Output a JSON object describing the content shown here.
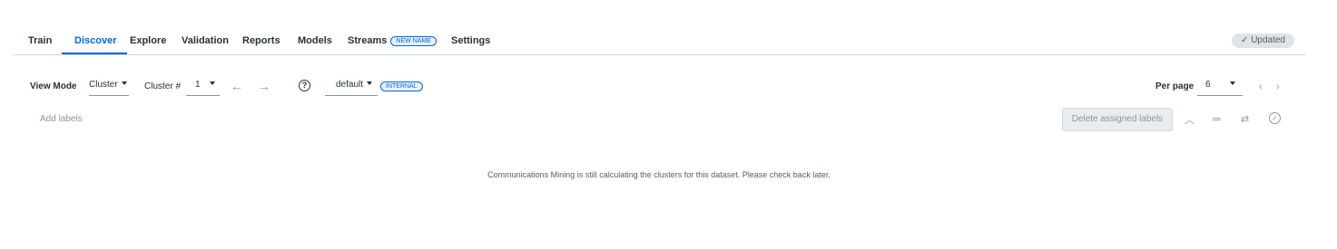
{
  "tabs": [
    {
      "label": "Train"
    },
    {
      "label": "Discover"
    },
    {
      "label": "Explore"
    },
    {
      "label": "Validation"
    },
    {
      "label": "Reports"
    },
    {
      "label": "Models"
    },
    {
      "label": "Streams",
      "badge": "NEW NAME"
    },
    {
      "label": "Settings"
    }
  ],
  "active_tab": "Discover",
  "status": {
    "label": "Updated",
    "icon": "check-icon"
  },
  "toolbar": {
    "view_mode_label": "View Mode",
    "view_mode_value": "Cluster",
    "cluster_num_label": "Cluster #",
    "cluster_num_value": "1",
    "prev_icon": "arrow-left-icon",
    "next_icon": "arrow-right-icon",
    "help_icon": "question-icon",
    "taxonomy_value": "default",
    "taxonomy_badge": "INTERNAL",
    "per_page_label": "Per page",
    "per_page_value": "6"
  },
  "labels_bar": {
    "add_labels_placeholder": "Add labels",
    "delete_button": "Delete assigned labels"
  },
  "message": "Communications Mining is still calculating the clusters for this dataset. Please check back later.",
  "colors": {
    "accent": "#0067df",
    "text": "#273139",
    "muted": "#8b959e"
  }
}
